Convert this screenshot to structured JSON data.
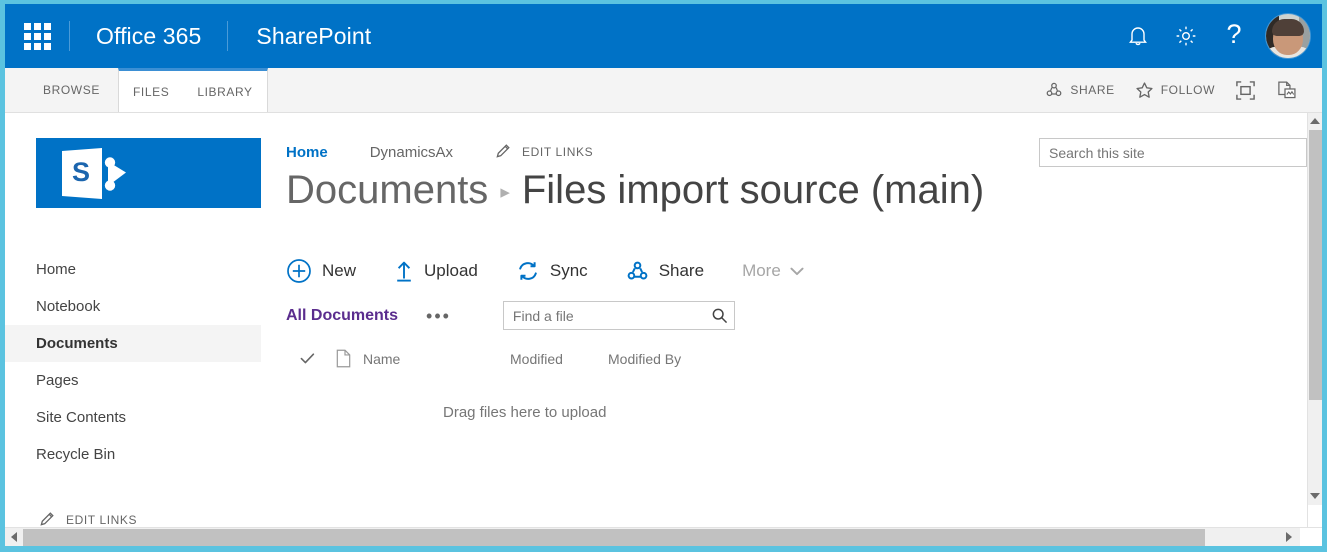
{
  "suite": {
    "waffle_icon": "app-launcher-waffle-icon",
    "brand": "Office 365",
    "app_name": "SharePoint",
    "notifications_icon": "bell-icon",
    "settings_icon": "gear-icon",
    "help_label": "?",
    "avatar_icon": "user-avatar-photo"
  },
  "ribbon": {
    "tabs": [
      {
        "label": "BROWSE",
        "selected": false
      },
      {
        "label": "FILES",
        "selected": true
      },
      {
        "label": "LIBRARY",
        "selected": false
      }
    ],
    "actions": [
      {
        "label": "SHARE",
        "icon": "share-icon"
      },
      {
        "label": "FOLLOW",
        "icon": "star-icon"
      },
      {
        "label": "",
        "icon": "focus-on-content-icon"
      },
      {
        "label": "",
        "icon": "page-sync-icon"
      }
    ]
  },
  "site": {
    "logo_icon": "sharepoint-logo",
    "logo_letter": "S"
  },
  "topnav": {
    "links": [
      {
        "label": "Home",
        "active": true
      },
      {
        "label": "DynamicsAx",
        "active": false
      }
    ],
    "edit_links_label": "EDIT LINKS",
    "edit_links_icon": "pencil-icon"
  },
  "search": {
    "placeholder": "Search this site",
    "value": ""
  },
  "title": {
    "parent": "Documents",
    "separator": "▸",
    "current": "Files import source (main)"
  },
  "commands": [
    {
      "label": "New",
      "icon": "plus-circle-icon"
    },
    {
      "label": "Upload",
      "icon": "upload-arrow-icon"
    },
    {
      "label": "Sync",
      "icon": "sync-icon"
    },
    {
      "label": "Share",
      "icon": "share-icon"
    },
    {
      "label": "More",
      "icon": "chevron-down-icon"
    }
  ],
  "view": {
    "name": "All Documents",
    "ellipsis": "•••",
    "find_placeholder": "Find a file",
    "find_value": "",
    "find_icon": "magnifier-icon"
  },
  "list": {
    "columns": [
      {
        "label": "",
        "name": "select-all-check"
      },
      {
        "label": "",
        "name": "doc-type-icon"
      },
      {
        "label": "Name"
      },
      {
        "label": "Modified"
      },
      {
        "label": "Modified By"
      }
    ],
    "rows": [],
    "empty_message": "Drag files here to upload"
  },
  "sidebar": {
    "items": [
      {
        "label": "Home",
        "selected": false
      },
      {
        "label": "Notebook",
        "selected": false
      },
      {
        "label": "Documents",
        "selected": true
      },
      {
        "label": "Pages",
        "selected": false
      },
      {
        "label": "Site Contents",
        "selected": false
      },
      {
        "label": "Recycle Bin",
        "selected": false
      }
    ],
    "edit_links_label": "EDIT LINKS",
    "edit_links_icon": "pencil-icon"
  },
  "colors": {
    "suite_bar": "#0072c6",
    "accent": "#0072c6",
    "tab_active_border": "#3b8fd4",
    "view_name": "#5b2d8e",
    "window_frame": "#5bc3e0",
    "ribbon_bg": "#f4f4f4"
  }
}
